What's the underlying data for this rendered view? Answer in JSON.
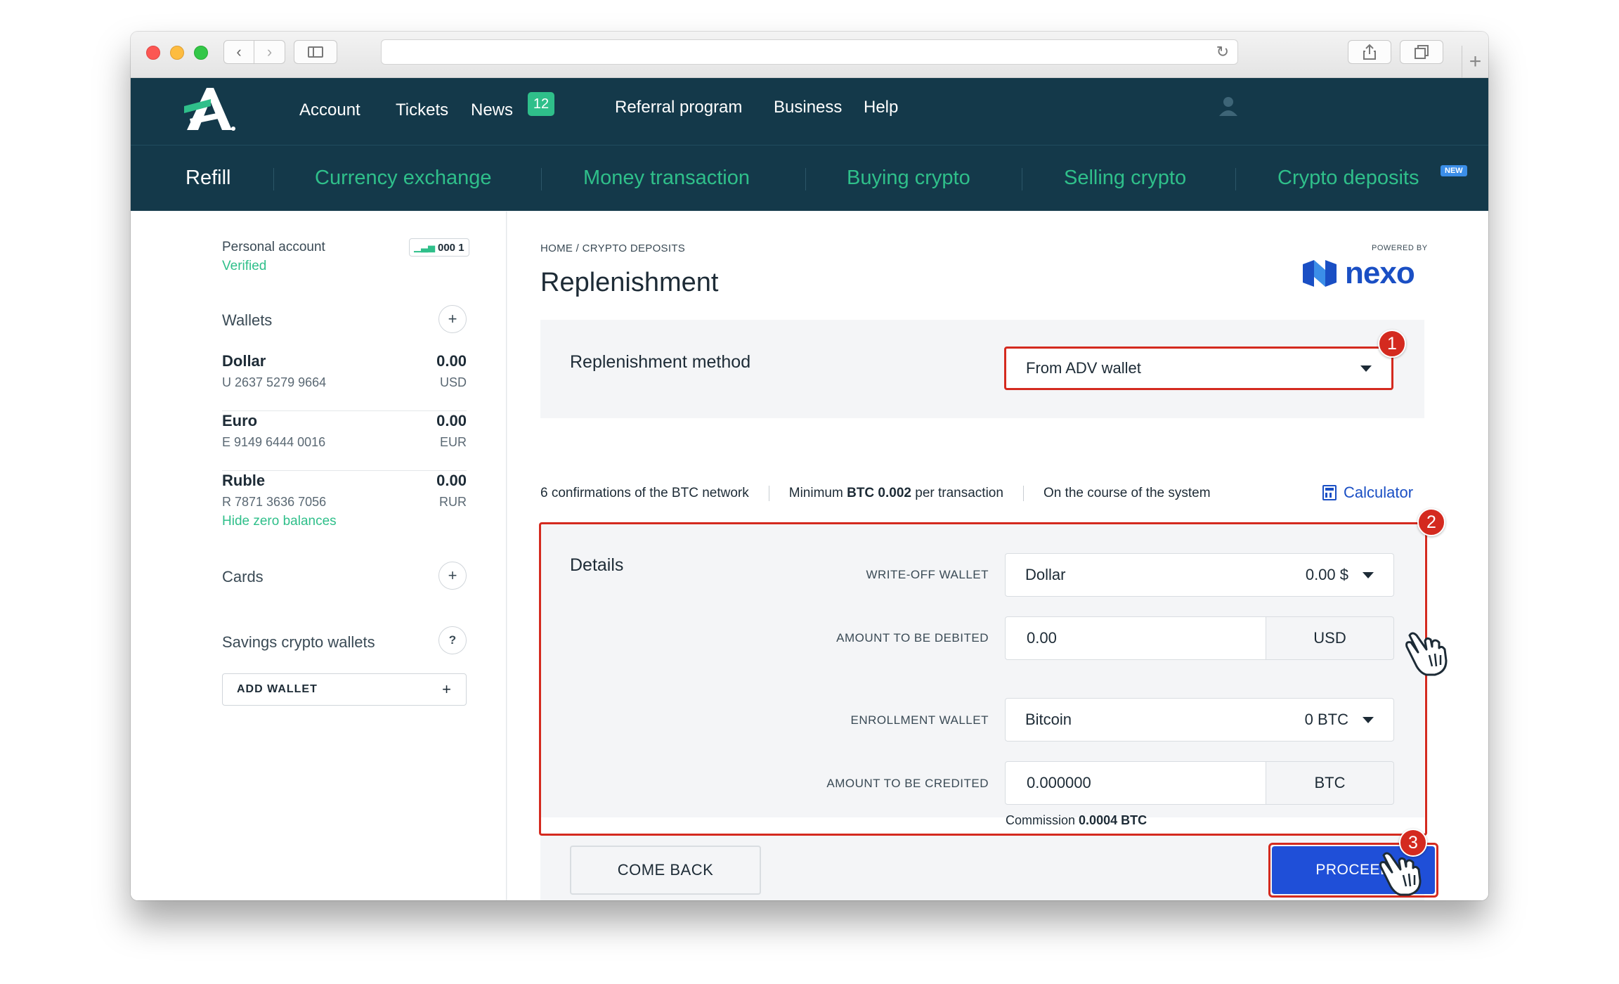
{
  "nav": {
    "items": [
      "Account",
      "Tickets",
      "News",
      "Referral program",
      "Business",
      "Help"
    ],
    "news_count": "12"
  },
  "subnav": {
    "items": [
      "Refill",
      "Currency exchange",
      "Money transaction",
      "Buying crypto",
      "Selling crypto",
      "Crypto deposits"
    ],
    "new_badge": "NEW"
  },
  "account": {
    "label": "Personal account",
    "status": "Verified",
    "id": "000 1"
  },
  "wallets": {
    "title": "Wallets",
    "items": [
      {
        "name": "Dollar",
        "number": "U 2637 5279 9664",
        "value": "0.00",
        "currency": "USD"
      },
      {
        "name": "Euro",
        "number": "E 9149 6444 0016",
        "value": "0.00",
        "currency": "EUR"
      },
      {
        "name": "Ruble",
        "number": "R 7871 3636 7056",
        "value": "0.00",
        "currency": "RUR"
      }
    ],
    "hide_zero": "Hide zero balances"
  },
  "cards": {
    "title": "Cards"
  },
  "savings": {
    "title": "Savings crypto wallets",
    "add_wallet": "ADD WALLET"
  },
  "main": {
    "breadcrumb": "HOME / CRYPTO DEPOSITS",
    "title": "Replenishment",
    "powered_by": "POWERED BY",
    "brand": "nexo",
    "method_label": "Replenishment method",
    "method_value": "From ADV wallet",
    "info": {
      "confirmations": "6 confirmations of the BTC network",
      "minimum_prefix": "Minimum",
      "minimum_value": "BTC 0.002",
      "minimum_suffix": "per transaction",
      "course": "On the course of the system",
      "calculator": "Calculator"
    },
    "details": {
      "title": "Details",
      "writeoff_label": "WRITE-OFF WALLET",
      "writeoff_wallet": "Dollar",
      "writeoff_balance": "0.00 $",
      "debit_label": "AMOUNT TO BE DEBITED",
      "debit_value": "0.00",
      "debit_currency": "USD",
      "enroll_label": "ENROLLMENT WALLET",
      "enroll_wallet": "Bitcoin",
      "enroll_balance": "0 BTC",
      "credit_label": "AMOUNT TO BE CREDITED",
      "credit_value": "0.000000",
      "credit_currency": "BTC",
      "commission_label": "Commission",
      "commission_value": "0.0004 BTC"
    },
    "buttons": {
      "back": "COME BACK",
      "proceed": "PROCEED"
    },
    "markers": [
      "1",
      "2",
      "3"
    ]
  }
}
